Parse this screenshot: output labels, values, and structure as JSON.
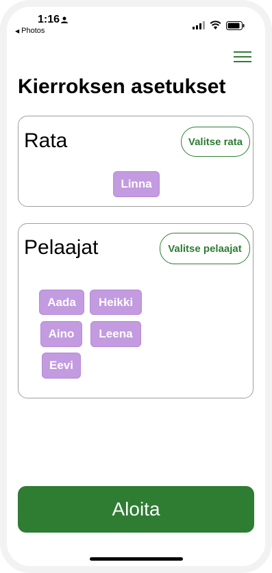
{
  "status_bar": {
    "time": "1:16",
    "back_app_label": "Photos",
    "back_arrow": "◀"
  },
  "header": {
    "menu_icon": "hamburger-menu-icon",
    "title": "Kierroksen asetukset"
  },
  "course_section": {
    "title": "Rata",
    "select_button_label": "Valitse rata",
    "selected_course": "Linna"
  },
  "players_section": {
    "title": "Pelaajat",
    "select_button_label": "Valitse pelaajat",
    "players": [
      "Aada",
      "Heikki",
      "Aino",
      "Leena",
      "Eevi"
    ]
  },
  "start_button_label": "Aloita",
  "colors": {
    "accent_green": "#2e7d32",
    "chip_purple": "#c39be0"
  }
}
